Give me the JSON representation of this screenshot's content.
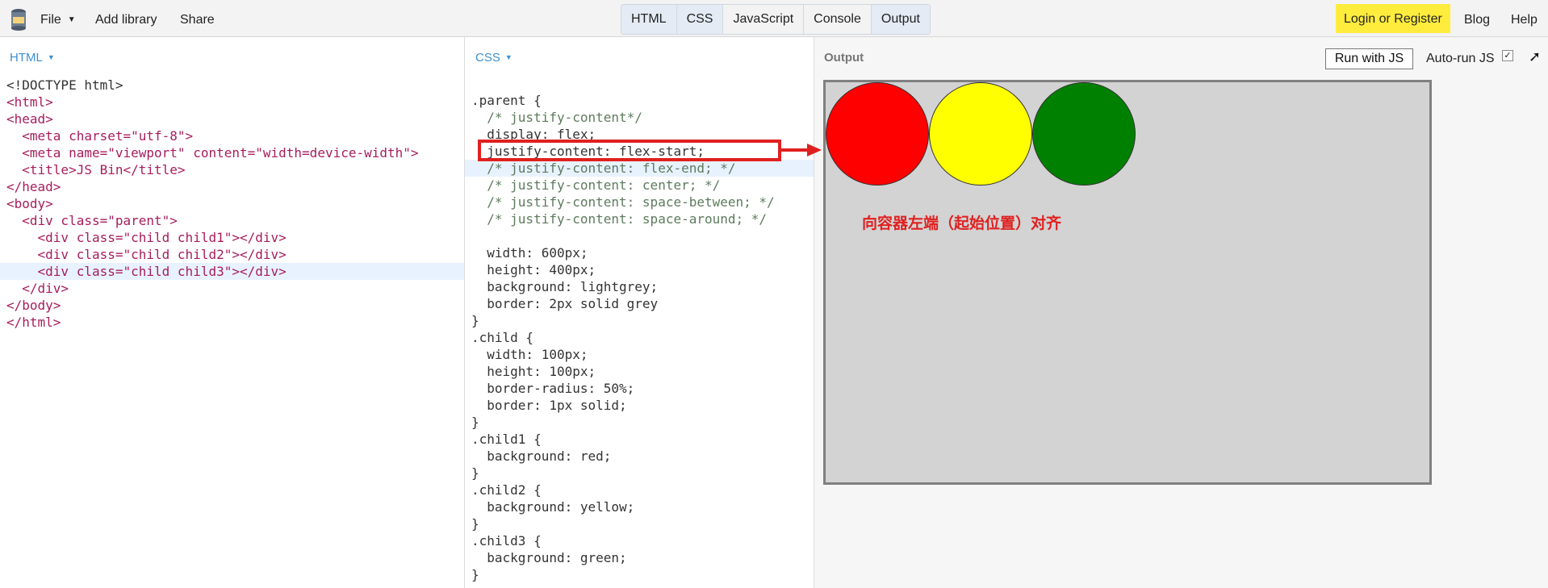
{
  "menu": {
    "file": "File",
    "add_library": "Add library",
    "share": "Share"
  },
  "tabs": [
    "HTML",
    "CSS",
    "JavaScript",
    "Console",
    "Output"
  ],
  "auth": {
    "login": "Login or Register",
    "blog": "Blog",
    "help": "Help"
  },
  "html_panel": {
    "label": "HTML",
    "lines": [
      [
        "<!DOCTYPE html>"
      ],
      [
        "<html>"
      ],
      [
        "<head>"
      ],
      [
        "  <meta charset=\"utf-8\">"
      ],
      [
        "  <meta name=\"viewport\" content=\"width=device-width\">"
      ],
      [
        "  <title>JS Bin</title>"
      ],
      [
        "</head>"
      ],
      [
        "<body>"
      ],
      [
        "  <div class=\"parent\">"
      ],
      [
        "    <div class=\"child child1\"></div>"
      ],
      [
        "    <div class=\"child child2\"></div>"
      ],
      [
        "    <div class=\"child child3\"></div>"
      ],
      [
        "  </div>"
      ],
      [
        "</body>"
      ],
      [
        "</html>"
      ]
    ]
  },
  "css_panel": {
    "label": "CSS",
    "lines": [
      ".parent {",
      "  /* justify-content*/",
      "  display: flex;",
      "  justify-content: flex-start;",
      "  /* justify-content: flex-end; */",
      "  /* justify-content: center; */",
      "  /* justify-content: space-between; */",
      "  /* justify-content: space-around; */",
      "",
      "  width: 600px;",
      "  height: 400px;",
      "  background: lightgrey;",
      "  border: 2px solid grey",
      "}",
      ".child {",
      "  width: 100px;",
      "  height: 100px;",
      "  border-radius: 50%;",
      "  border: 1px solid;",
      "}",
      ".child1 {",
      "  background: red;",
      "}",
      ".child2 {",
      "  background: yellow;",
      "}",
      ".child3 {",
      "  background: green;",
      "}"
    ]
  },
  "output_panel": {
    "label": "Output",
    "run_button": "Run with JS",
    "autorun_label": "Auto-run JS",
    "autorun_checked": true,
    "children": [
      {
        "name": "child1",
        "color": "#ff0000"
      },
      {
        "name": "child2",
        "color": "#ffff00"
      },
      {
        "name": "child3",
        "color": "#008000"
      }
    ],
    "annotation": "向容器左端（起始位置）对齐"
  },
  "colors": {
    "login_bg": "#ffec3d",
    "highlight": "#e02020",
    "active_tab": "#e4ebf4"
  }
}
